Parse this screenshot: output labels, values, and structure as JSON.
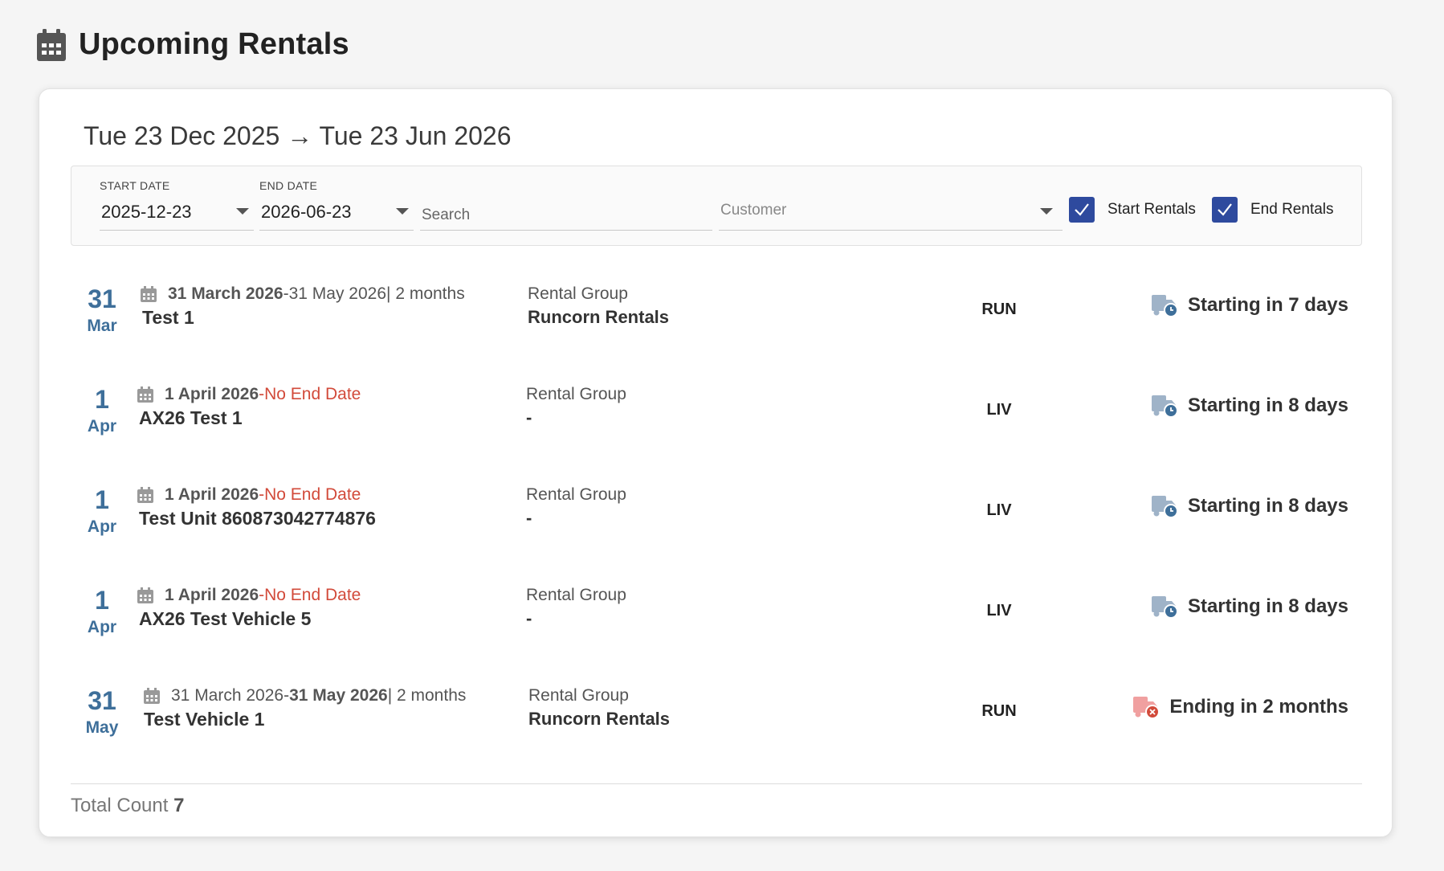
{
  "header": {
    "title": "Upcoming Rentals",
    "icon": "calendar-icon"
  },
  "range_title": "Tue 23 Dec 2025 → Tue 23 Jun 2026",
  "filters": {
    "start_date": {
      "label": "START DATE",
      "value": "2025-12-23"
    },
    "end_date": {
      "label": "END DATE",
      "value": "2026-06-23"
    },
    "search": {
      "placeholder": "Search"
    },
    "customer": {
      "placeholder": "Customer"
    },
    "start_rentals": {
      "label": "Start Rentals",
      "checked": true
    },
    "end_rentals": {
      "label": "End Rentals",
      "checked": true
    }
  },
  "rentals": [
    {
      "day": "31",
      "month": "Mar",
      "start": "31 March 2026",
      "start_bold": true,
      "sep": " - ",
      "end": "31 May 2026",
      "end_bold": false,
      "duration": " | 2 months",
      "no_end": false,
      "name": "Test 1",
      "group_label": "Rental Group",
      "group_value": "Runcorn Rentals",
      "code": "RUN",
      "status": "Starting in 7 days",
      "status_type": "starting"
    },
    {
      "day": "1",
      "month": "Apr",
      "start": "1 April 2026",
      "start_bold": true,
      "sep": " - ",
      "end": "No End Date",
      "end_bold": false,
      "duration": "",
      "no_end": true,
      "name": "AX26 Test 1",
      "group_label": "Rental Group",
      "group_value": "-",
      "code": "LIV",
      "status": "Starting in 8 days",
      "status_type": "starting"
    },
    {
      "day": "1",
      "month": "Apr",
      "start": "1 April 2026",
      "start_bold": true,
      "sep": " - ",
      "end": "No End Date",
      "end_bold": false,
      "duration": "",
      "no_end": true,
      "name": "Test Unit 860873042774876",
      "group_label": "Rental Group",
      "group_value": "-",
      "code": "LIV",
      "status": "Starting in 8 days",
      "status_type": "starting"
    },
    {
      "day": "1",
      "month": "Apr",
      "start": "1 April 2026",
      "start_bold": true,
      "sep": " - ",
      "end": "No End Date",
      "end_bold": false,
      "duration": "",
      "no_end": true,
      "name": "AX26 Test Vehicle 5",
      "group_label": "Rental Group",
      "group_value": "-",
      "code": "LIV",
      "status": "Starting in 8 days",
      "status_type": "starting"
    },
    {
      "day": "31",
      "month": "May",
      "start": "31 March 2026",
      "start_bold": false,
      "sep": " - ",
      "end": "31 May 2026",
      "end_bold": true,
      "duration": " | 2 months",
      "no_end": false,
      "name": "Test Vehicle 1",
      "group_label": "Rental Group",
      "group_value": "Runcorn Rentals",
      "code": "RUN",
      "status": "Ending in 2 months",
      "status_type": "ending"
    }
  ],
  "footer": {
    "total_label": "Total Count",
    "total_value": "7"
  },
  "colors": {
    "accent": "#3e6f9a",
    "checkbox": "#2e4a9e",
    "no_end": "#d24a3a",
    "truck_start": "#9fb3c8",
    "truck_end": "#f0a0a0"
  }
}
